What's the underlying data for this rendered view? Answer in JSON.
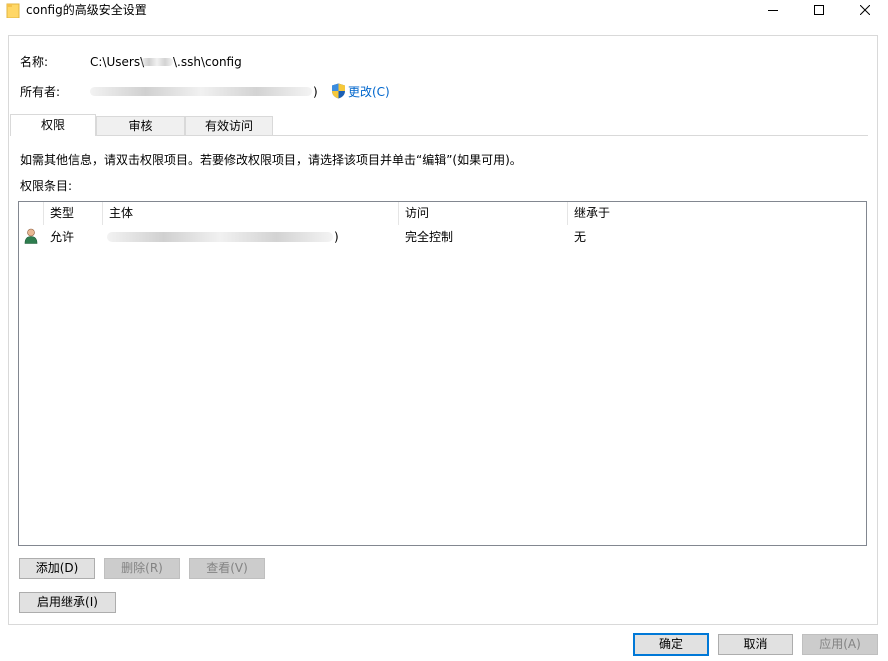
{
  "window": {
    "title": "config的高级安全设置"
  },
  "info": {
    "name_label": "名称:",
    "name_value": "C:\\Users\\",
    "name_value_tail": "\\.ssh\\config",
    "owner_label": "所有者:",
    "owner_value_tail": ")",
    "change_link": "更改(C)"
  },
  "tabs": [
    {
      "label": "权限"
    },
    {
      "label": "审核"
    },
    {
      "label": "有效访问"
    }
  ],
  "permissions": {
    "hint": "如需其他信息，请双击权限项目。若要修改权限项目，请选择该项目并单击“编辑”(如果可用)。",
    "entries_label": "权限条目:",
    "columns": [
      "类型",
      "主体",
      "访问",
      "继承于"
    ],
    "rows": [
      {
        "type": "允许",
        "principal_tail": ")",
        "access": "完全控制",
        "inherited_from": "无"
      }
    ]
  },
  "buttons": {
    "add": "添加(D)",
    "remove": "删除(R)",
    "view": "查看(V)",
    "enable_inheritance": "启用继承(I)",
    "ok": "确定",
    "cancel": "取消",
    "apply": "应用(A)"
  },
  "colors": {
    "accent": "#0078d7",
    "link": "#0066cc",
    "folder": "#ffd766"
  },
  "icons": {
    "title": "folder-icon",
    "shield": "uac-shield-icon",
    "entry": "user-icon"
  }
}
